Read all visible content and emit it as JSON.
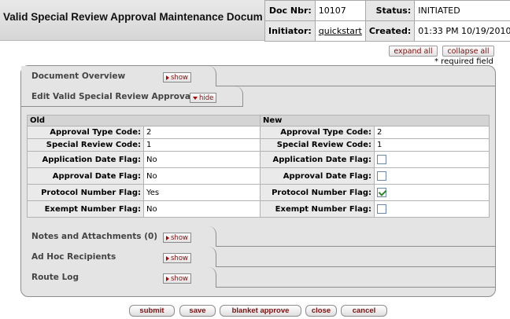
{
  "header": {
    "title": "Valid Special Review Approval Maintenance Document",
    "doc_nbr_label": "Doc Nbr:",
    "doc_nbr": "10107",
    "status_label": "Status:",
    "status": "INITIATED",
    "initiator_label": "Initiator:",
    "initiator": "quickstart",
    "created_label": "Created:",
    "created": "01:33 PM 10/19/2010"
  },
  "controls": {
    "expand_all": "expand all",
    "collapse_all": "collapse all",
    "required_note": "* required field"
  },
  "tabs": {
    "document_overview": {
      "label": "Document Overview",
      "button": "show"
    },
    "edit_panel": {
      "label": "Edit Valid Special Review Approval",
      "button": "hide"
    },
    "notes": {
      "label": "Notes and Attachments (0)",
      "button": "show"
    },
    "adhoc": {
      "label": "Ad Hoc Recipients",
      "button": "show"
    },
    "route_log": {
      "label": "Route Log",
      "button": "show"
    }
  },
  "table": {
    "old_header": "Old",
    "new_header": "New",
    "rows": [
      {
        "label": "Approval Type Code:",
        "old": "2",
        "new": "2"
      },
      {
        "label": "Special Review Code:",
        "old": "1",
        "new": "1"
      },
      {
        "label": "Application Date Flag:",
        "old": "No",
        "new_checked": false
      },
      {
        "label": "Approval Date Flag:",
        "old": "No",
        "new_checked": false
      },
      {
        "label": "Protocol Number Flag:",
        "old": "Yes",
        "new_checked": true
      },
      {
        "label": "Exempt Number Flag:",
        "old": "No",
        "new_checked": false
      }
    ]
  },
  "actions": {
    "submit": "submit",
    "save": "save",
    "blanket_approve": "blanket approve",
    "close": "close",
    "cancel": "cancel"
  }
}
